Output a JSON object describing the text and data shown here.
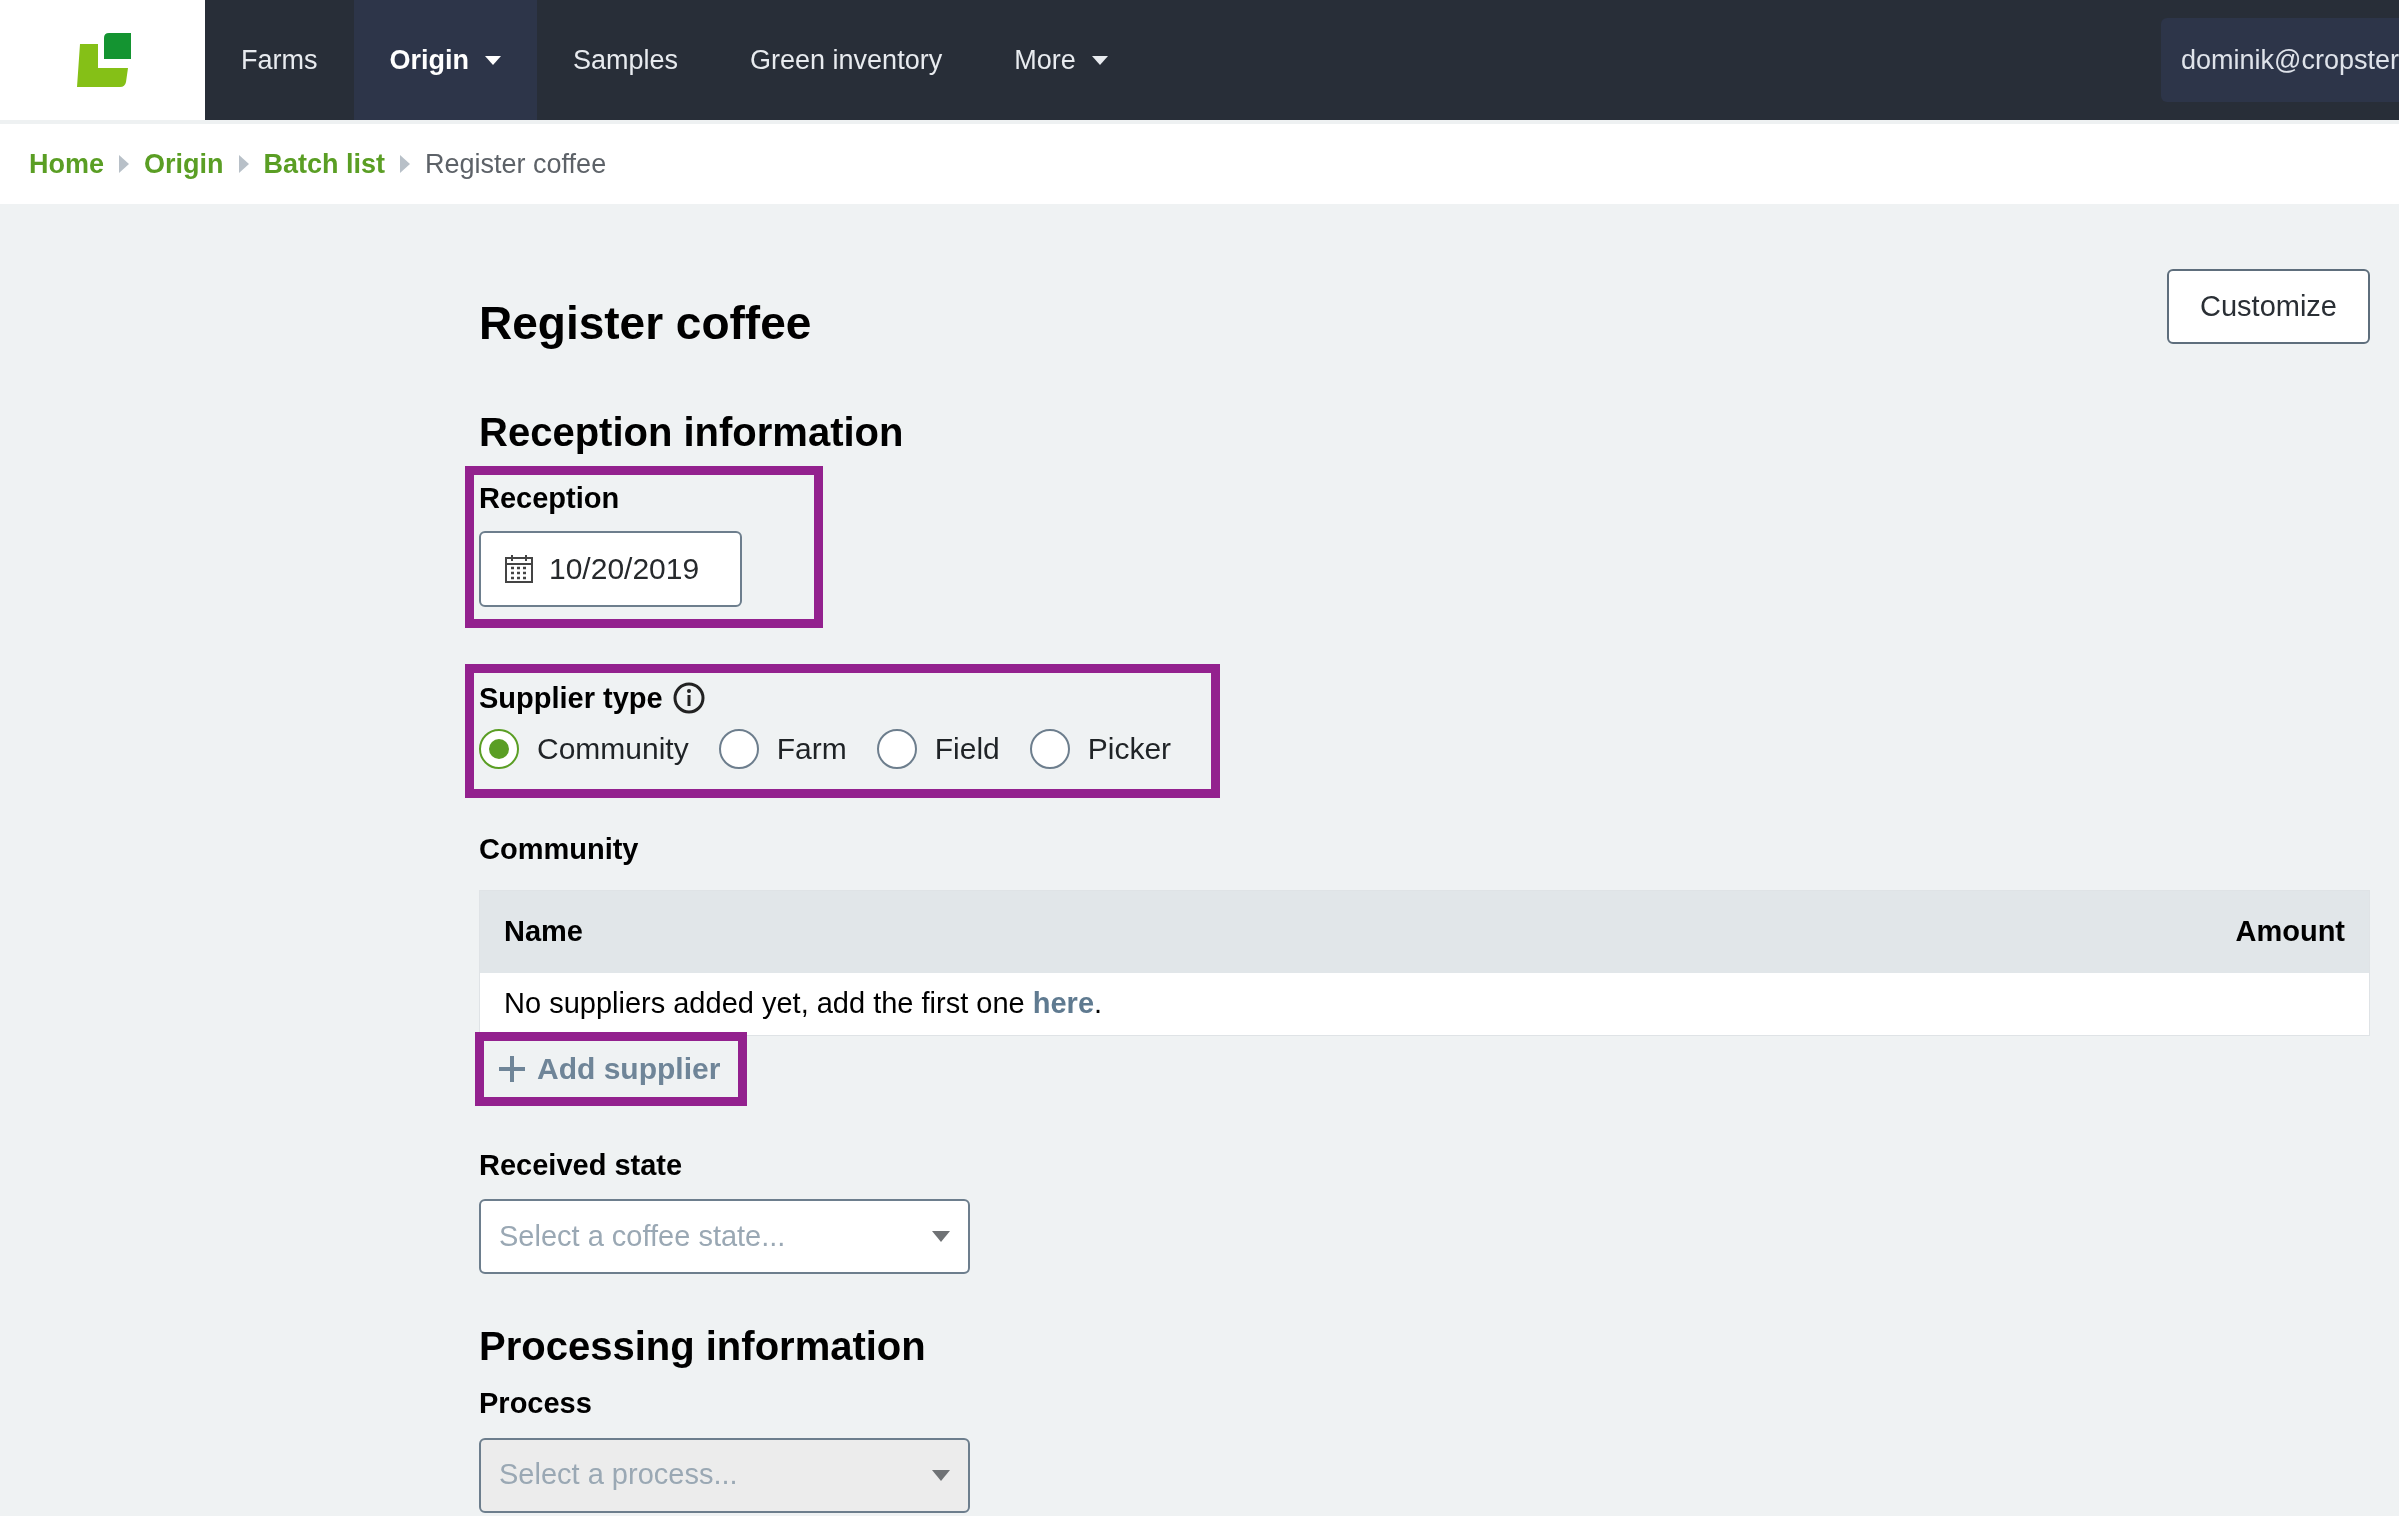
{
  "nav": {
    "items": [
      {
        "label": "Farms",
        "selected": false,
        "dropdown": false
      },
      {
        "label": "Origin",
        "selected": true,
        "dropdown": true
      },
      {
        "label": "Samples",
        "selected": false,
        "dropdown": false
      },
      {
        "label": "Green inventory",
        "selected": false,
        "dropdown": false
      },
      {
        "label": "More",
        "selected": false,
        "dropdown": true
      }
    ],
    "user": "dominik@cropster"
  },
  "breadcrumbs": [
    {
      "label": "Home",
      "link": true
    },
    {
      "label": "Origin",
      "link": true
    },
    {
      "label": "Batch list",
      "link": true
    },
    {
      "label": "Register coffee",
      "link": false
    }
  ],
  "page_title": "Register coffee",
  "customize_button": "Customize",
  "reception_section": {
    "heading": "Reception information",
    "reception": {
      "label": "Reception",
      "value": "10/20/2019",
      "highlighted": true
    },
    "supplier_type": {
      "label": "Supplier type",
      "highlighted": true,
      "options": [
        {
          "label": "Community",
          "selected": true
        },
        {
          "label": "Farm",
          "selected": false
        },
        {
          "label": "Field",
          "selected": false
        },
        {
          "label": "Picker",
          "selected": false
        }
      ]
    },
    "suppliers": {
      "label": "Community",
      "columns": [
        "Name",
        "Amount"
      ],
      "empty_text": "No suppliers added yet, add the first one ",
      "empty_link": "here",
      "empty_end": "."
    },
    "add_supplier": {
      "label": "Add supplier",
      "highlighted": true
    },
    "received_state": {
      "label": "Received state",
      "placeholder": "Select a coffee state...",
      "disabled": false,
      "highlighted": false
    }
  },
  "processing_section": {
    "heading": "Processing information",
    "process": {
      "label": "Process",
      "placeholder": "Select a process...",
      "disabled": true,
      "highlighted": false
    }
  }
}
